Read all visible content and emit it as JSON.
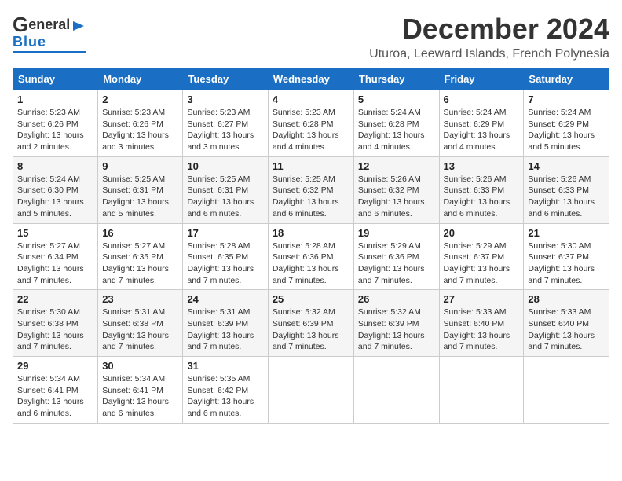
{
  "header": {
    "logo_general": "General",
    "logo_blue": "Blue",
    "month_title": "December 2024",
    "location": "Uturoa, Leeward Islands, French Polynesia"
  },
  "weekdays": [
    "Sunday",
    "Monday",
    "Tuesday",
    "Wednesday",
    "Thursday",
    "Friday",
    "Saturday"
  ],
  "weeks": [
    [
      {
        "day": "1",
        "sunrise": "5:23 AM",
        "sunset": "6:26 PM",
        "daylight": "13 hours and 2 minutes."
      },
      {
        "day": "2",
        "sunrise": "5:23 AM",
        "sunset": "6:26 PM",
        "daylight": "13 hours and 3 minutes."
      },
      {
        "day": "3",
        "sunrise": "5:23 AM",
        "sunset": "6:27 PM",
        "daylight": "13 hours and 3 minutes."
      },
      {
        "day": "4",
        "sunrise": "5:23 AM",
        "sunset": "6:28 PM",
        "daylight": "13 hours and 4 minutes."
      },
      {
        "day": "5",
        "sunrise": "5:24 AM",
        "sunset": "6:28 PM",
        "daylight": "13 hours and 4 minutes."
      },
      {
        "day": "6",
        "sunrise": "5:24 AM",
        "sunset": "6:29 PM",
        "daylight": "13 hours and 4 minutes."
      },
      {
        "day": "7",
        "sunrise": "5:24 AM",
        "sunset": "6:29 PM",
        "daylight": "13 hours and 5 minutes."
      }
    ],
    [
      {
        "day": "8",
        "sunrise": "5:24 AM",
        "sunset": "6:30 PM",
        "daylight": "13 hours and 5 minutes."
      },
      {
        "day": "9",
        "sunrise": "5:25 AM",
        "sunset": "6:31 PM",
        "daylight": "13 hours and 5 minutes."
      },
      {
        "day": "10",
        "sunrise": "5:25 AM",
        "sunset": "6:31 PM",
        "daylight": "13 hours and 6 minutes."
      },
      {
        "day": "11",
        "sunrise": "5:25 AM",
        "sunset": "6:32 PM",
        "daylight": "13 hours and 6 minutes."
      },
      {
        "day": "12",
        "sunrise": "5:26 AM",
        "sunset": "6:32 PM",
        "daylight": "13 hours and 6 minutes."
      },
      {
        "day": "13",
        "sunrise": "5:26 AM",
        "sunset": "6:33 PM",
        "daylight": "13 hours and 6 minutes."
      },
      {
        "day": "14",
        "sunrise": "5:26 AM",
        "sunset": "6:33 PM",
        "daylight": "13 hours and 6 minutes."
      }
    ],
    [
      {
        "day": "15",
        "sunrise": "5:27 AM",
        "sunset": "6:34 PM",
        "daylight": "13 hours and 7 minutes."
      },
      {
        "day": "16",
        "sunrise": "5:27 AM",
        "sunset": "6:35 PM",
        "daylight": "13 hours and 7 minutes."
      },
      {
        "day": "17",
        "sunrise": "5:28 AM",
        "sunset": "6:35 PM",
        "daylight": "13 hours and 7 minutes."
      },
      {
        "day": "18",
        "sunrise": "5:28 AM",
        "sunset": "6:36 PM",
        "daylight": "13 hours and 7 minutes."
      },
      {
        "day": "19",
        "sunrise": "5:29 AM",
        "sunset": "6:36 PM",
        "daylight": "13 hours and 7 minutes."
      },
      {
        "day": "20",
        "sunrise": "5:29 AM",
        "sunset": "6:37 PM",
        "daylight": "13 hours and 7 minutes."
      },
      {
        "day": "21",
        "sunrise": "5:30 AM",
        "sunset": "6:37 PM",
        "daylight": "13 hours and 7 minutes."
      }
    ],
    [
      {
        "day": "22",
        "sunrise": "5:30 AM",
        "sunset": "6:38 PM",
        "daylight": "13 hours and 7 minutes."
      },
      {
        "day": "23",
        "sunrise": "5:31 AM",
        "sunset": "6:38 PM",
        "daylight": "13 hours and 7 minutes."
      },
      {
        "day": "24",
        "sunrise": "5:31 AM",
        "sunset": "6:39 PM",
        "daylight": "13 hours and 7 minutes."
      },
      {
        "day": "25",
        "sunrise": "5:32 AM",
        "sunset": "6:39 PM",
        "daylight": "13 hours and 7 minutes."
      },
      {
        "day": "26",
        "sunrise": "5:32 AM",
        "sunset": "6:39 PM",
        "daylight": "13 hours and 7 minutes."
      },
      {
        "day": "27",
        "sunrise": "5:33 AM",
        "sunset": "6:40 PM",
        "daylight": "13 hours and 7 minutes."
      },
      {
        "day": "28",
        "sunrise": "5:33 AM",
        "sunset": "6:40 PM",
        "daylight": "13 hours and 7 minutes."
      }
    ],
    [
      {
        "day": "29",
        "sunrise": "5:34 AM",
        "sunset": "6:41 PM",
        "daylight": "13 hours and 6 minutes."
      },
      {
        "day": "30",
        "sunrise": "5:34 AM",
        "sunset": "6:41 PM",
        "daylight": "13 hours and 6 minutes."
      },
      {
        "day": "31",
        "sunrise": "5:35 AM",
        "sunset": "6:42 PM",
        "daylight": "13 hours and 6 minutes."
      },
      null,
      null,
      null,
      null
    ]
  ],
  "labels": {
    "sunrise": "Sunrise:",
    "sunset": "Sunset:",
    "daylight": "Daylight:"
  }
}
